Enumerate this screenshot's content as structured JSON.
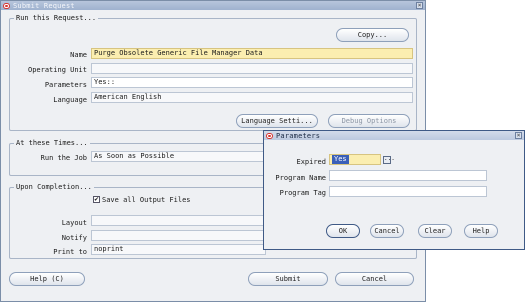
{
  "main_window": {
    "title": "Submit Request",
    "run_request": {
      "section_label": "Run this Request...",
      "copy_button": "Copy...",
      "name_label": "Name",
      "name_value": "Purge Obsolete Generic File Manager Data",
      "operating_unit_label": "Operating Unit",
      "operating_unit_value": "",
      "parameters_label": "Parameters",
      "parameters_value": "Yes::",
      "language_label": "Language",
      "language_value": "American English",
      "language_settings_button": "Language Setti...",
      "debug_options_button": "Debug Options"
    },
    "schedule": {
      "section_label": "At these Times...",
      "run_job_label": "Run the Job",
      "run_job_value": "As Soon as Possible"
    },
    "completion": {
      "section_label": "Upon Completion...",
      "save_output_checked": true,
      "save_output_label": "Save all Output Files",
      "layout_label": "Layout",
      "layout_value": "",
      "notify_label": "Notify",
      "notify_value": "",
      "print_to_label": "Print to",
      "print_to_value": "noprint"
    },
    "footer": {
      "help_button": "Help (C)",
      "submit_button": "Submit",
      "cancel_button": "Cancel"
    }
  },
  "parameters_dialog": {
    "title": "Parameters",
    "expired_label": "Expired",
    "expired_value": "Yes",
    "program_name_label": "Program Name",
    "program_name_value": "",
    "program_tag_label": "Program Tag",
    "program_tag_value": "",
    "ok_button": "OK",
    "cancel_button": "Cancel",
    "clear_button": "Clear",
    "help_button": "Help"
  },
  "colors": {
    "required_field": "#fbeeb0",
    "selection": "#3a5fb8",
    "oracle_red": "#d8342f"
  },
  "icons": [
    "oracle-logo-icon",
    "close-icon",
    "checkmark-icon",
    "list-of-values-icon"
  ]
}
